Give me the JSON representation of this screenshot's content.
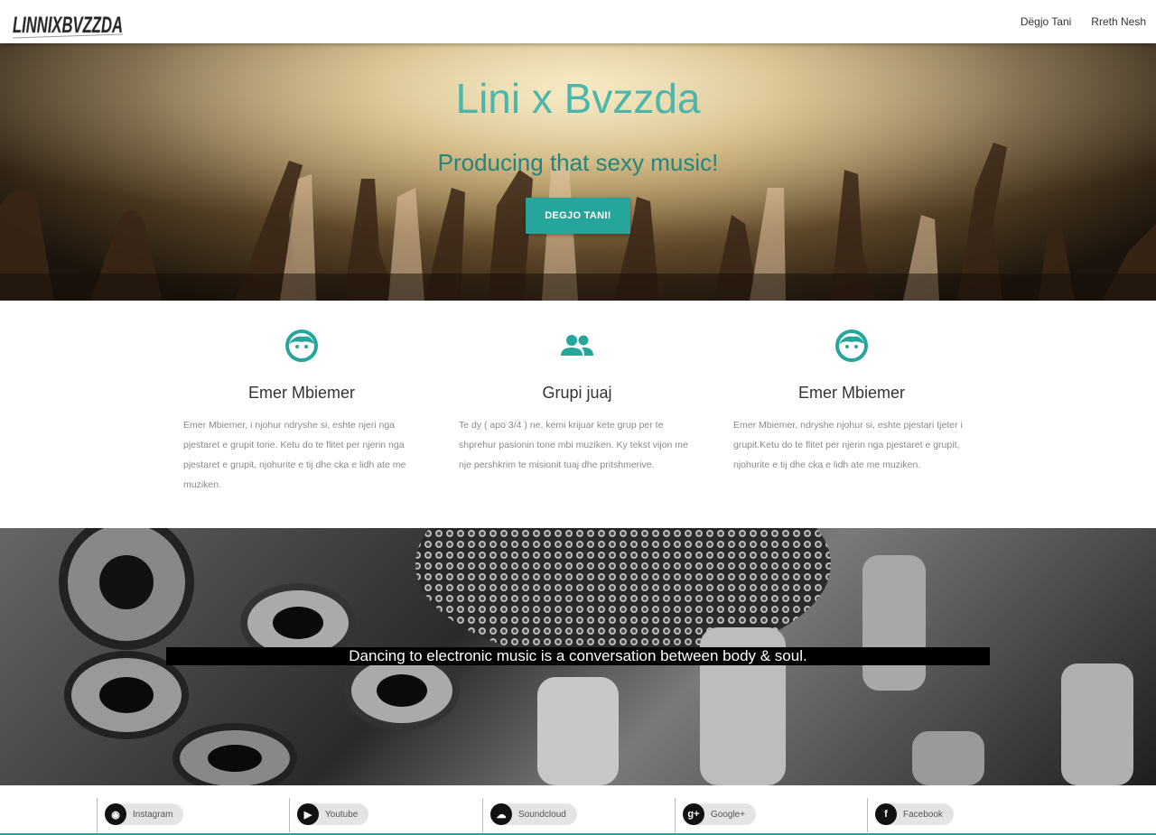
{
  "nav": {
    "logo_text": "LINNIXBVZZDA",
    "links": [
      "Dëgjo Tani",
      "Rreth Nesh"
    ]
  },
  "hero": {
    "title": "Lini x Bvzzda",
    "subtitle": "Producing that sexy music!",
    "button": "DEGJO TANI!"
  },
  "features": [
    {
      "icon": "face-icon",
      "title": "Emer Mbiemer",
      "text": "Emer Mbiemer, i njohur ndryshe si, eshte njeri nga pjestaret e grupit tone. Ketu do te flitet per njerin nga pjestaret e grupit, njohurite e tij dhe cka e lidh ate me muziken."
    },
    {
      "icon": "group-icon",
      "title": "Grupi juaj",
      "text": "Te dy ( apo 3/4 ) ne, kemi krijuar kete grup per te shprehur pasionin tone mbi muziken. Ky tekst vijon me nje pershkrim te misionit tuaj dhe pritshmerive."
    },
    {
      "icon": "face-icon",
      "title": "Emer Mbiemer",
      "text": "Emer Mbiemer, ndryshe njohur si, eshte pjestari tjeter i grupit.Ketu do te flitet per njerin nga pjestaret e grupit, njohurite e tij dhe cka e lidh ate me muziken."
    }
  ],
  "quote": "Dancing to electronic music is a conversation between body & soul.",
  "social": [
    {
      "label": "Instagram",
      "icon": "instagram-icon",
      "glyph": "◉"
    },
    {
      "label": "Youtube",
      "icon": "youtube-icon",
      "glyph": "▶"
    },
    {
      "label": "Soundcloud",
      "icon": "soundcloud-icon",
      "glyph": "☁"
    },
    {
      "label": "Google+",
      "icon": "googleplus-icon",
      "glyph": "g+"
    },
    {
      "label": "Facebook",
      "icon": "facebook-icon",
      "glyph": "f"
    }
  ],
  "colors": {
    "accent": "#26a69a",
    "title": "#4db6ac"
  }
}
